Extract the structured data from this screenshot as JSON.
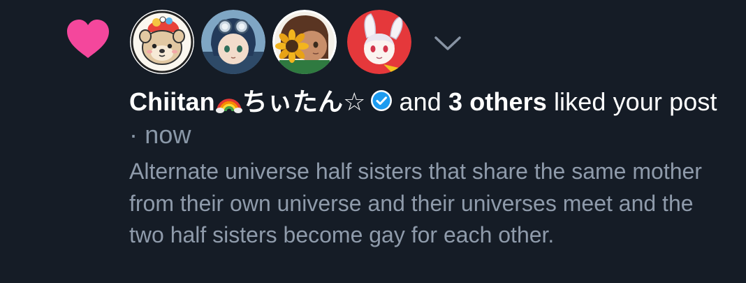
{
  "notification": {
    "type_icon": "heart-icon",
    "heart_color": "#f4479c",
    "avatars": [
      {
        "icon": "avatar-bear-icon"
      },
      {
        "icon": "avatar-boy-goggles-icon"
      },
      {
        "icon": "avatar-sunflower-icon"
      },
      {
        "icon": "avatar-bunny-icon"
      }
    ],
    "expand_icon": "chevron-down-icon",
    "user_name": "Chiitan",
    "user_emoji": "rainbow-icon",
    "user_name_jp": "ちぃたん☆",
    "verified_icon": "verified-check-icon",
    "verified_color": "#1d9bf0",
    "and_text": "and",
    "others_text": "3 others",
    "action_text": "liked your post",
    "separator": "·",
    "time": "now",
    "post_text": "Alternate universe half sisters that share the same mother from their own universe and their universes meet and the two half sisters become gay for each other."
  }
}
